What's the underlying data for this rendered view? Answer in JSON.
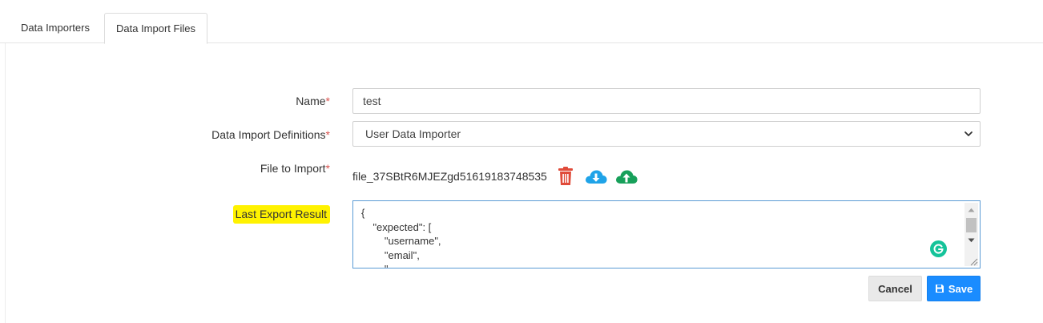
{
  "tabs": [
    {
      "label": "Data Importers",
      "active": false
    },
    {
      "label": "Data Import Files",
      "active": true
    }
  ],
  "form": {
    "name_label": "Name",
    "name_value": "test",
    "definitions_label": "Data Import Definitions",
    "definitions_value": "User Data Importer",
    "file_label": "File to Import",
    "file_name": "file_37SBtR6MJEZgd51619183748535",
    "file_icons": [
      "trash-icon",
      "cloud-download-icon",
      "cloud-upload-icon"
    ],
    "last_result_label": "Last Export Result",
    "last_result_value": "{\n    \"expected\": [\n        \"username\",\n        \"email\",\n        \"..."
  },
  "required_marker": "*",
  "actions": {
    "cancel_label": "Cancel",
    "save_label": "Save"
  },
  "colors": {
    "required": "#d9534f",
    "trash": "#e04b3a",
    "download": "#1fa3e8",
    "upload": "#17a05a",
    "save_button": "#1a8cff",
    "highlight": "#fff200",
    "grammarly": "#15c39a"
  }
}
